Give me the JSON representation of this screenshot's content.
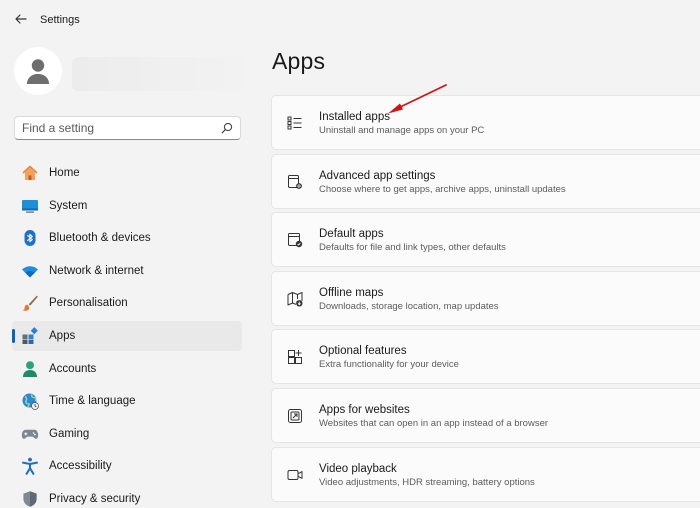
{
  "window": {
    "title": "Settings"
  },
  "sidebar": {
    "search_placeholder": "Find a setting",
    "items": [
      {
        "label": "Home",
        "icon": "home-icon"
      },
      {
        "label": "System",
        "icon": "system-icon"
      },
      {
        "label": "Bluetooth & devices",
        "icon": "bluetooth-icon"
      },
      {
        "label": "Network & internet",
        "icon": "wifi-icon"
      },
      {
        "label": "Personalisation",
        "icon": "brush-icon"
      },
      {
        "label": "Apps",
        "icon": "apps-icon",
        "selected": true
      },
      {
        "label": "Accounts",
        "icon": "accounts-icon"
      },
      {
        "label": "Time & language",
        "icon": "globe-icon"
      },
      {
        "label": "Gaming",
        "icon": "gamepad-icon"
      },
      {
        "label": "Accessibility",
        "icon": "accessibility-icon"
      },
      {
        "label": "Privacy & security",
        "icon": "shield-icon"
      }
    ]
  },
  "main": {
    "title": "Apps",
    "cards": [
      {
        "title": "Installed apps",
        "subtitle": "Uninstall and manage apps on your PC",
        "icon": "list-icon"
      },
      {
        "title": "Advanced app settings",
        "subtitle": "Choose where to get apps, archive apps, uninstall updates",
        "icon": "app-settings-icon"
      },
      {
        "title": "Default apps",
        "subtitle": "Defaults for file and link types, other defaults",
        "icon": "default-apps-icon"
      },
      {
        "title": "Offline maps",
        "subtitle": "Downloads, storage location, map updates",
        "icon": "map-icon"
      },
      {
        "title": "Optional features",
        "subtitle": "Extra functionality for your device",
        "icon": "optional-features-icon"
      },
      {
        "title": "Apps for websites",
        "subtitle": "Websites that can open in an app instead of a browser",
        "icon": "open-in-app-icon"
      },
      {
        "title": "Video playback",
        "subtitle": "Video adjustments, HDR streaming, battery options",
        "icon": "video-icon"
      }
    ]
  },
  "colors": {
    "accent": "#0067c0",
    "annotation_arrow": "#d11414"
  }
}
